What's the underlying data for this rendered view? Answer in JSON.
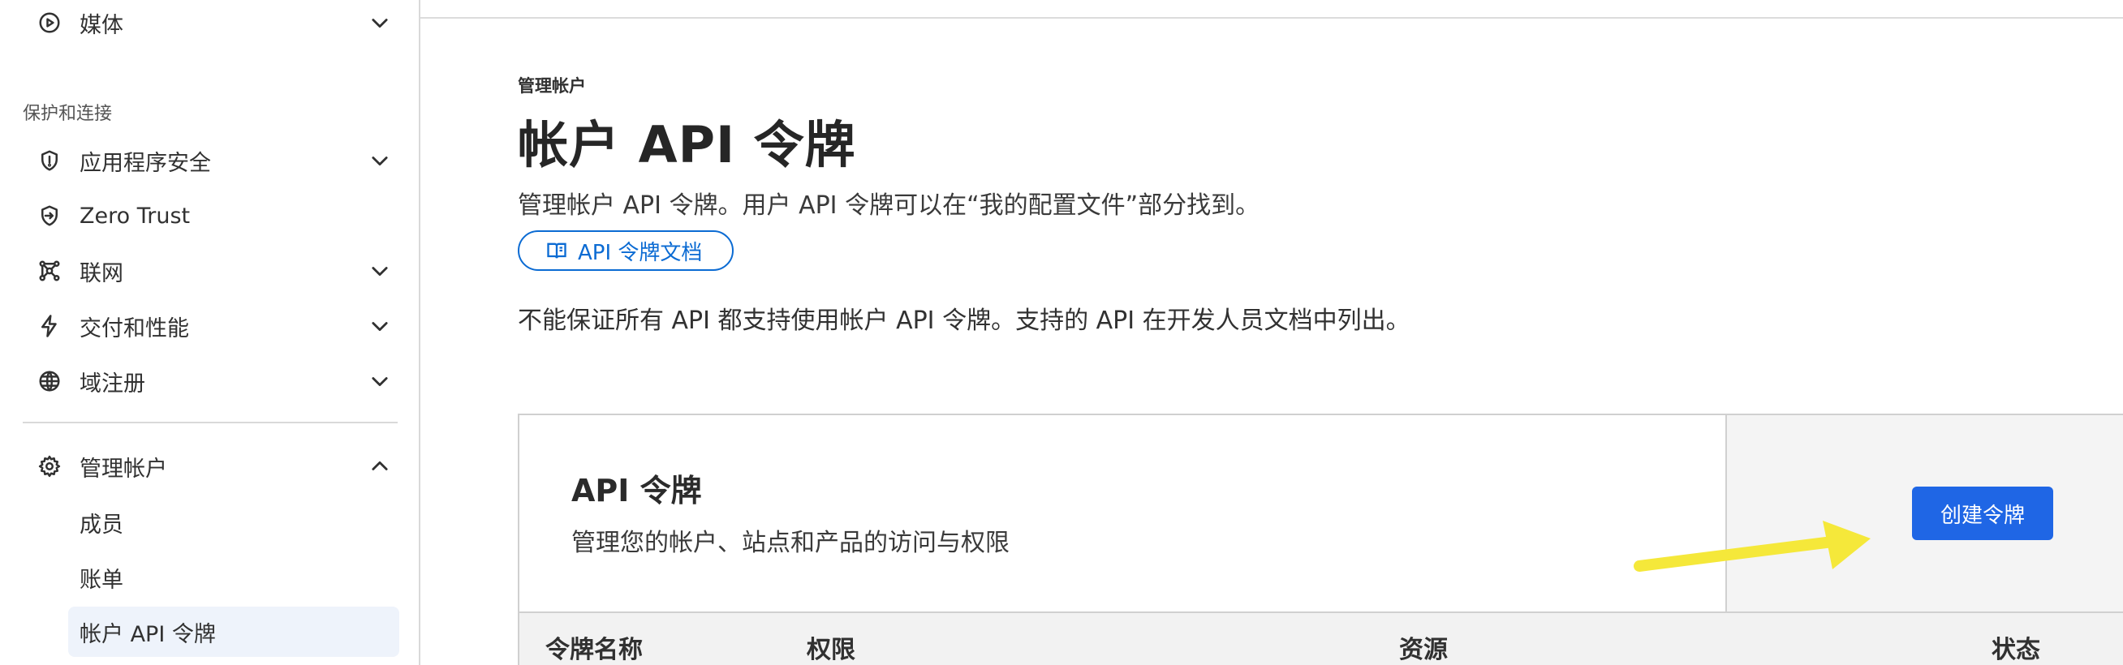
{
  "sidebar": {
    "items_top": [
      {
        "label": "媒体",
        "icon": "play-circle-icon",
        "chevron": "down"
      }
    ],
    "section_title": "保护和连接",
    "items": [
      {
        "label": "应用程序安全",
        "icon": "shield-icon",
        "chevron": "down"
      },
      {
        "label": "Zero Trust",
        "icon": "zero-trust-icon",
        "chevron": ""
      },
      {
        "label": "联网",
        "icon": "network-icon",
        "chevron": "down"
      },
      {
        "label": "交付和性能",
        "icon": "bolt-icon",
        "chevron": "down"
      },
      {
        "label": "域注册",
        "icon": "globe-icon",
        "chevron": "down"
      }
    ],
    "manage": {
      "label": "管理帐户",
      "icon": "gear-icon",
      "chevron": "up"
    },
    "sub_items": [
      {
        "label": "成员",
        "active": false
      },
      {
        "label": "账单",
        "active": false
      },
      {
        "label": "帐户 API 令牌",
        "active": true
      }
    ]
  },
  "main": {
    "eyebrow": "管理帐户",
    "title": "帐户 API 令牌",
    "description": "管理帐户 API 令牌。用户 API 令牌可以在“我的配置文件”部分找到。",
    "doc_button": "API 令牌文档",
    "notice": "不能保证所有 API 都支持使用帐户 API 令牌。支持的 API 在开发人员文档中列出。"
  },
  "card": {
    "title": "API 令牌",
    "subtitle": "管理您的帐户、站点和产品的访问与权限",
    "create_button": "创建令牌",
    "columns": [
      "令牌名称",
      "权限",
      "资源",
      "状态"
    ]
  },
  "colors": {
    "accent": "#1f66e5",
    "link": "#0b6bd3",
    "annotation_arrow": "#f5e83a"
  }
}
